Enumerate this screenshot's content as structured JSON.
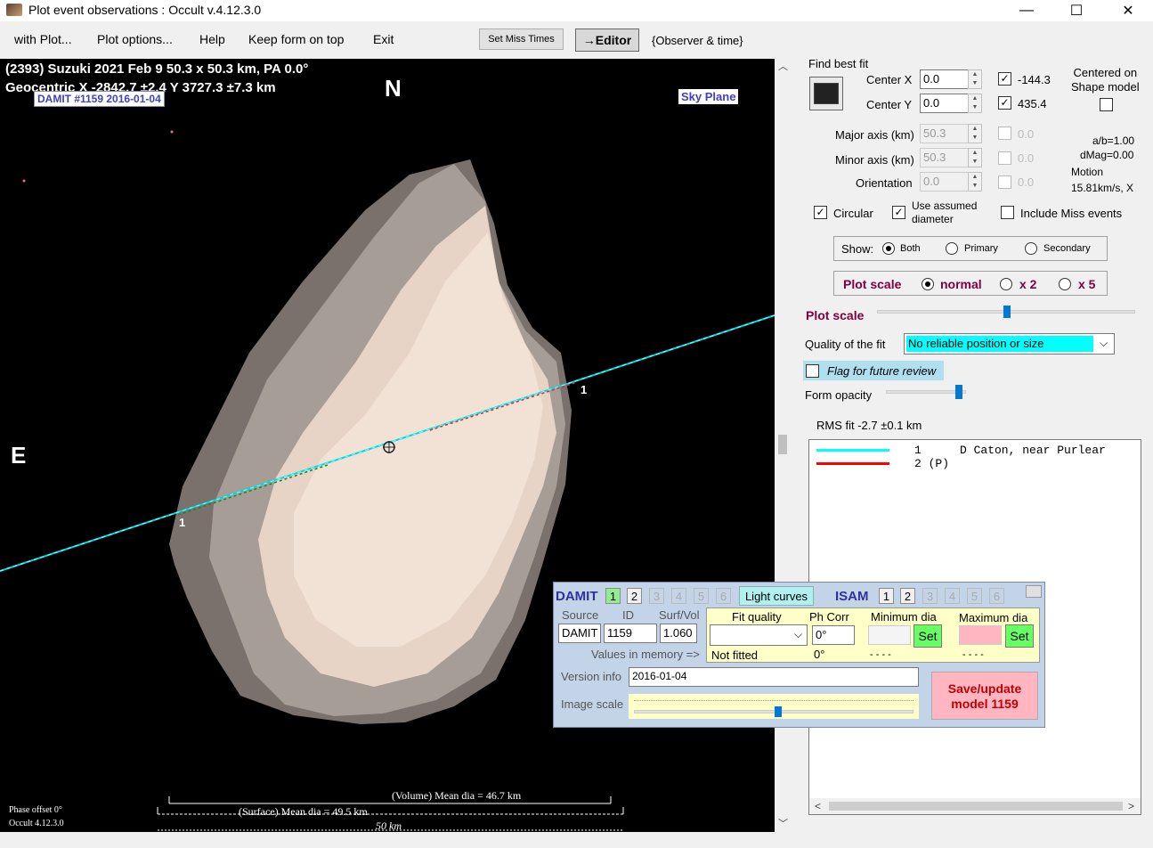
{
  "window": {
    "title": "Plot event observations : Occult v.4.12.3.0",
    "minimize": "—",
    "maximize": "☐",
    "close": "✕"
  },
  "menu": {
    "items": [
      "with Plot...",
      "Plot options...",
      "Help",
      "Keep form on top",
      "Exit"
    ],
    "set_miss_times": "Set Miss Times",
    "editor": "→Editor",
    "observer_time": "{Observer & time}"
  },
  "plot": {
    "title_line1": "(2393) Suzuki  2021 Feb 9   50.3 x 50.3 km, PA 0.0°",
    "title_line2": "Geocentric  X -2842.7 ±2.4  Y 3727.3 ±7.3 km",
    "damit_label": "DAMIT #1159 2016-01-04",
    "north": "N",
    "east": "E",
    "sky_plane": "Sky Plane",
    "chord_label": "1",
    "volume_dia": "(Volume) Mean dia = 46.7 km",
    "surface_dia": "(Surface) Mean dia = 49.5 km",
    "scale_bar": "50 km",
    "phase_offset": "Phase offset 0°",
    "version": "Occult 4.12.3.0"
  },
  "panel": {
    "find_best_fit": "Find best fit",
    "center_x_label": "Center X",
    "center_x": "0.0",
    "center_x_chk": "-144.3",
    "center_y_label": "Center Y",
    "center_y": "0.0",
    "center_y_chk": "435.4",
    "centered_on": "Centered on\nShape model",
    "major_label": "Major axis (km)",
    "major": "50.3",
    "major_chk": "0.0",
    "minor_label": "Minor axis (km)",
    "minor": "50.3",
    "minor_chk": "0.0",
    "orient_label": "Orientation",
    "orient": "0.0",
    "orient_chk": "0.0",
    "ab": "a/b=1.00",
    "dmag": "dMag=0.00",
    "motion_label": "Motion",
    "motion": "15.81km/s, X",
    "circular": "Circular",
    "use_assumed": "Use assumed\ndiameter",
    "include_miss": "Include Miss events",
    "show_label": "Show:",
    "show_both": "Both",
    "show_primary": "Primary",
    "show_secondary": "Secondary",
    "plot_scale": "Plot scale",
    "scale_normal": "normal",
    "scale_x2": "x 2",
    "scale_x5": "x 5",
    "plot_scale_slider": "Plot scale",
    "quality_label": "Quality of the fit",
    "quality_value": "No reliable position or size",
    "flag_review": "Flag for future review",
    "form_opacity": "Form opacity",
    "rms_fit": "RMS fit -2.7 ±0.1 km",
    "list": [
      {
        "num": "1",
        "text": "D Caton, near Purlear",
        "color": "#00ffff"
      },
      {
        "num": "2 (P)",
        "text": "",
        "color": "#ff0000"
      }
    ]
  },
  "damit_panel": {
    "damit": "DAMIT",
    "tabs": [
      "1",
      "2",
      "3",
      "4",
      "5",
      "6"
    ],
    "light_curves": "Light curves",
    "isam": "ISAM",
    "isam_tabs": [
      "1",
      "2",
      "3",
      "4",
      "5",
      "6"
    ],
    "source_label": "Source",
    "id_label": "ID",
    "surf_label": "Surf/Vol",
    "source": "DAMIT",
    "id": "1159",
    "surf": "1.060",
    "fit_quality": "Fit quality",
    "ph_corr": "Ph Corr",
    "min_dia": "Minimum dia",
    "max_dia": "Maximum dia",
    "ph_corr_val": "0°",
    "set": "Set",
    "values_mem": "Values in memory =>",
    "not_fitted": "Not fitted",
    "ph_mem": "0°",
    "dash1": "- - - -",
    "dash2": "- - - -",
    "version_label": "Version info",
    "version": "2016-01-04",
    "image_scale": "Image scale",
    "save": "Save/update\nmodel 1159"
  }
}
